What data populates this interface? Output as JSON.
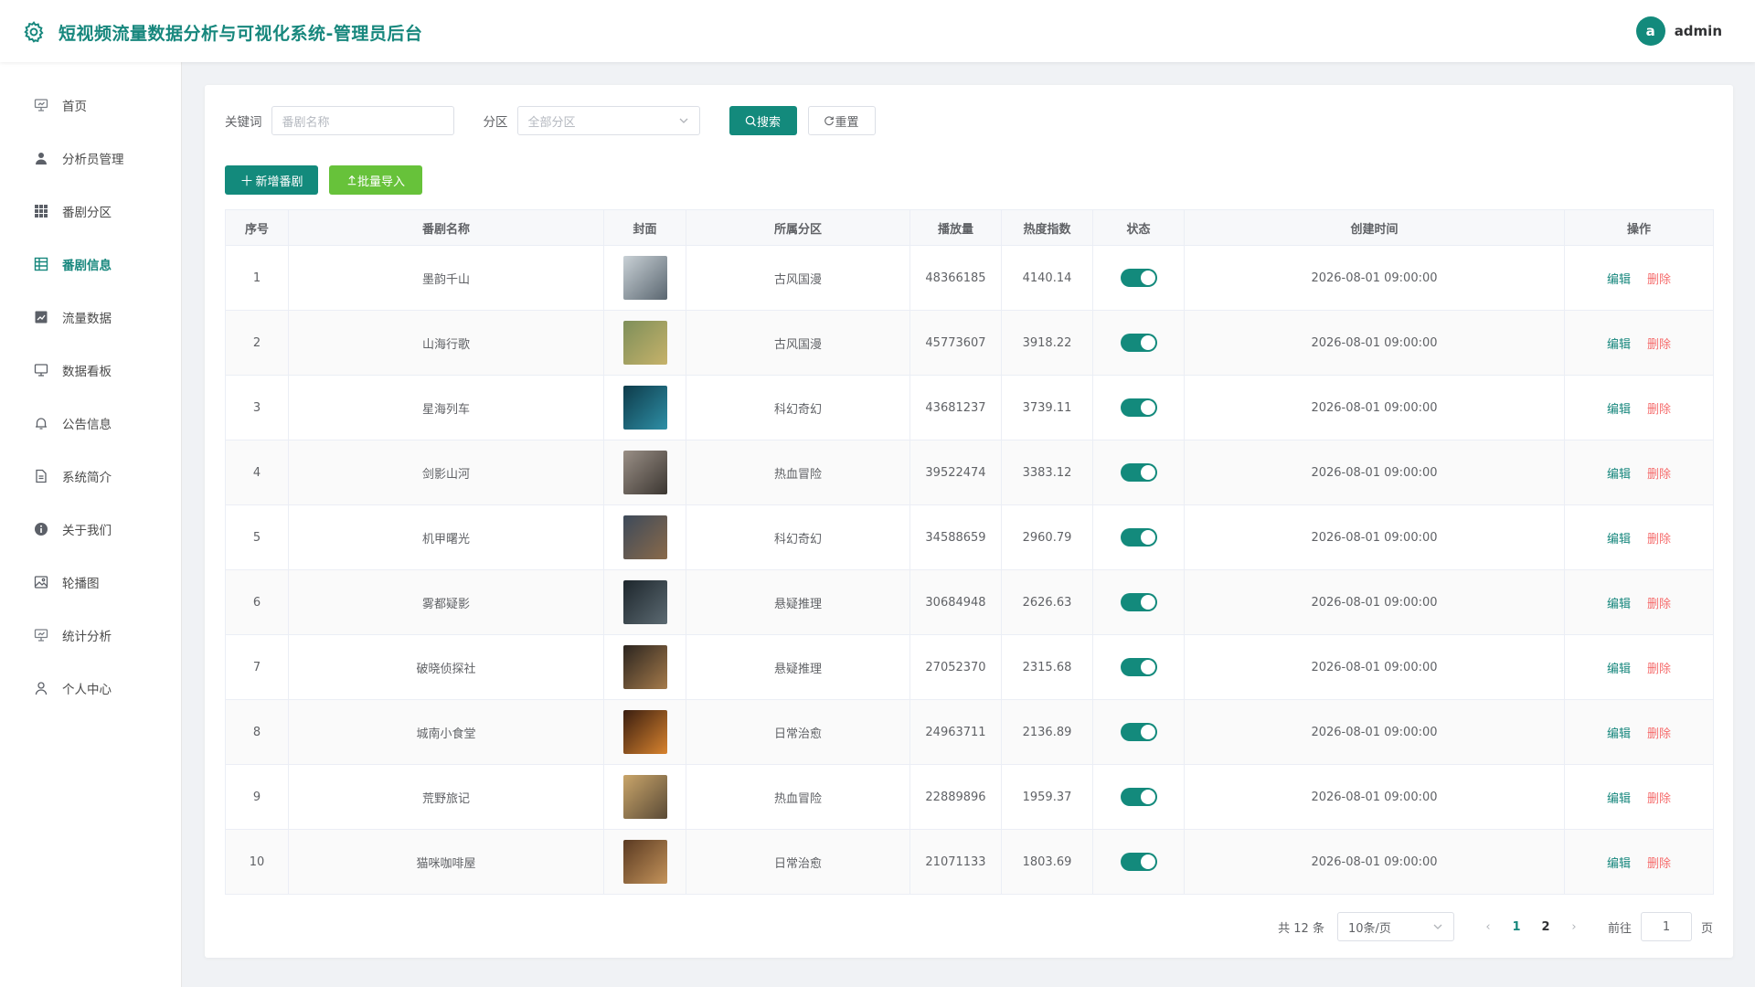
{
  "header": {
    "title": "短视频流量数据分析与可视化系统-管理员后台",
    "avatar_letter": "a",
    "username": "admin"
  },
  "colors": {
    "brand": "#138a7c",
    "secondary_btn": "#67c23a",
    "danger": "#f56c6c"
  },
  "sidebar": {
    "items": [
      {
        "label": "首页",
        "icon": "monitor-home-icon"
      },
      {
        "label": "分析员管理",
        "icon": "user-icon"
      },
      {
        "label": "番剧分区",
        "icon": "grid-icon"
      },
      {
        "label": "番剧信息",
        "icon": "table-icon",
        "active": true
      },
      {
        "label": "流量数据",
        "icon": "trend-chart-icon"
      },
      {
        "label": "数据看板",
        "icon": "monitor-icon"
      },
      {
        "label": "公告信息",
        "icon": "bell-icon"
      },
      {
        "label": "系统简介",
        "icon": "document-icon"
      },
      {
        "label": "关于我们",
        "icon": "info-icon"
      },
      {
        "label": "轮播图",
        "icon": "picture-icon"
      },
      {
        "label": "统计分析",
        "icon": "data-analysis-icon"
      },
      {
        "label": "个人中心",
        "icon": "person-icon"
      }
    ]
  },
  "search": {
    "keyword_label": "关键词",
    "keyword_placeholder": "番剧名称",
    "category_label": "分区",
    "category_placeholder": "全部分区",
    "search_button": "搜索",
    "reset_button": "重置"
  },
  "actions": {
    "add_button": "新增番剧",
    "import_button": "批量导入"
  },
  "table": {
    "columns": [
      "序号",
      "番剧名称",
      "封面",
      "所属分区",
      "播放量",
      "热度指数",
      "状态",
      "创建时间",
      "操作"
    ],
    "edit_label": "编辑",
    "delete_label": "删除",
    "rows": [
      {
        "index": "1",
        "name": "墨韵千山",
        "cover": [
          "#c9d1d6",
          "#5a6670"
        ],
        "category": "古风国漫",
        "plays": "48366185",
        "heat": "4140.14",
        "status": true,
        "created": "2026-08-01 09:00:00"
      },
      {
        "index": "2",
        "name": "山海行歌",
        "cover": [
          "#7e8f5a",
          "#c6b26a"
        ],
        "category": "古风国漫",
        "plays": "45773607",
        "heat": "3918.22",
        "status": true,
        "created": "2026-08-01 09:00:00"
      },
      {
        "index": "3",
        "name": "星海列车",
        "cover": [
          "#0e3b4a",
          "#2e8fa6"
        ],
        "category": "科幻奇幻",
        "plays": "43681237",
        "heat": "3739.11",
        "status": true,
        "created": "2026-08-01 09:00:00"
      },
      {
        "index": "4",
        "name": "剑影山河",
        "cover": [
          "#9a8f86",
          "#3b3631"
        ],
        "category": "热血冒险",
        "plays": "39522474",
        "heat": "3383.12",
        "status": true,
        "created": "2026-08-01 09:00:00"
      },
      {
        "index": "5",
        "name": "机甲曙光",
        "cover": [
          "#3d4a5a",
          "#8a6a4a"
        ],
        "category": "科幻奇幻",
        "plays": "34588659",
        "heat": "2960.79",
        "status": true,
        "created": "2026-08-01 09:00:00"
      },
      {
        "index": "6",
        "name": "雾都疑影",
        "cover": [
          "#1d262c",
          "#5c6a72"
        ],
        "category": "悬疑推理",
        "plays": "30684948",
        "heat": "2626.63",
        "status": true,
        "created": "2026-08-01 09:00:00"
      },
      {
        "index": "7",
        "name": "破晓侦探社",
        "cover": [
          "#2b2520",
          "#a57a4a"
        ],
        "category": "悬疑推理",
        "plays": "27052370",
        "heat": "2315.68",
        "status": true,
        "created": "2026-08-01 09:00:00"
      },
      {
        "index": "8",
        "name": "城南小食堂",
        "cover": [
          "#3a1e10",
          "#d8832e"
        ],
        "category": "日常治愈",
        "plays": "24963711",
        "heat": "2136.89",
        "status": true,
        "created": "2026-08-01 09:00:00"
      },
      {
        "index": "9",
        "name": "荒野旅记",
        "cover": [
          "#c9a56a",
          "#5a4a36"
        ],
        "category": "热血冒险",
        "plays": "22889896",
        "heat": "1959.37",
        "status": true,
        "created": "2026-08-01 09:00:00"
      },
      {
        "index": "10",
        "name": "猫咪咖啡屋",
        "cover": [
          "#5a3a22",
          "#c4935a"
        ],
        "category": "日常治愈",
        "plays": "21071133",
        "heat": "1803.69",
        "status": true,
        "created": "2026-08-01 09:00:00"
      }
    ]
  },
  "pagination": {
    "total_text": "共 12 条",
    "page_size": "10条/页",
    "pages": [
      "1",
      "2"
    ],
    "current": "1",
    "goto_label": "前往",
    "goto_value": "1",
    "page_suffix": "页"
  }
}
